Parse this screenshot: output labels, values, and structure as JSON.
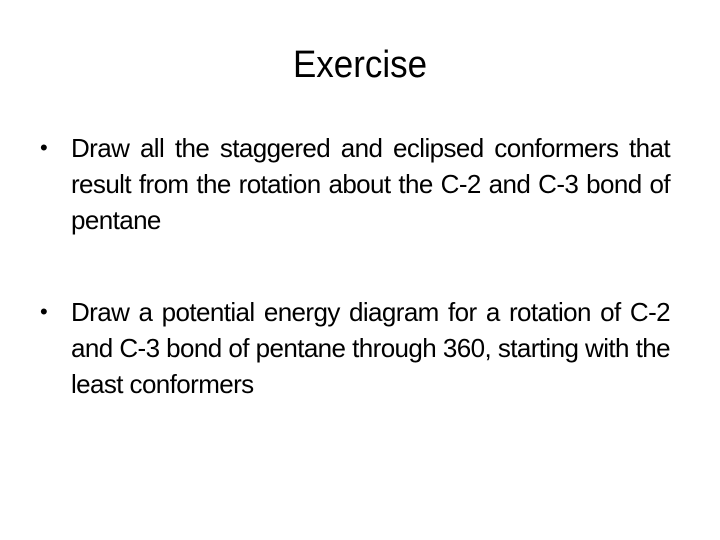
{
  "slide": {
    "title": "Exercise",
    "bullet_glyph": "•",
    "bullets": [
      {
        "text": "Draw all the staggered and eclipsed conformers that result from the rotation about the C-2 and C-3 bond of pentane"
      },
      {
        "text": "Draw a potential energy diagram for a rotation of C-2 and C-3 bond of pentane through 360, starting with the least conformers"
      }
    ]
  }
}
